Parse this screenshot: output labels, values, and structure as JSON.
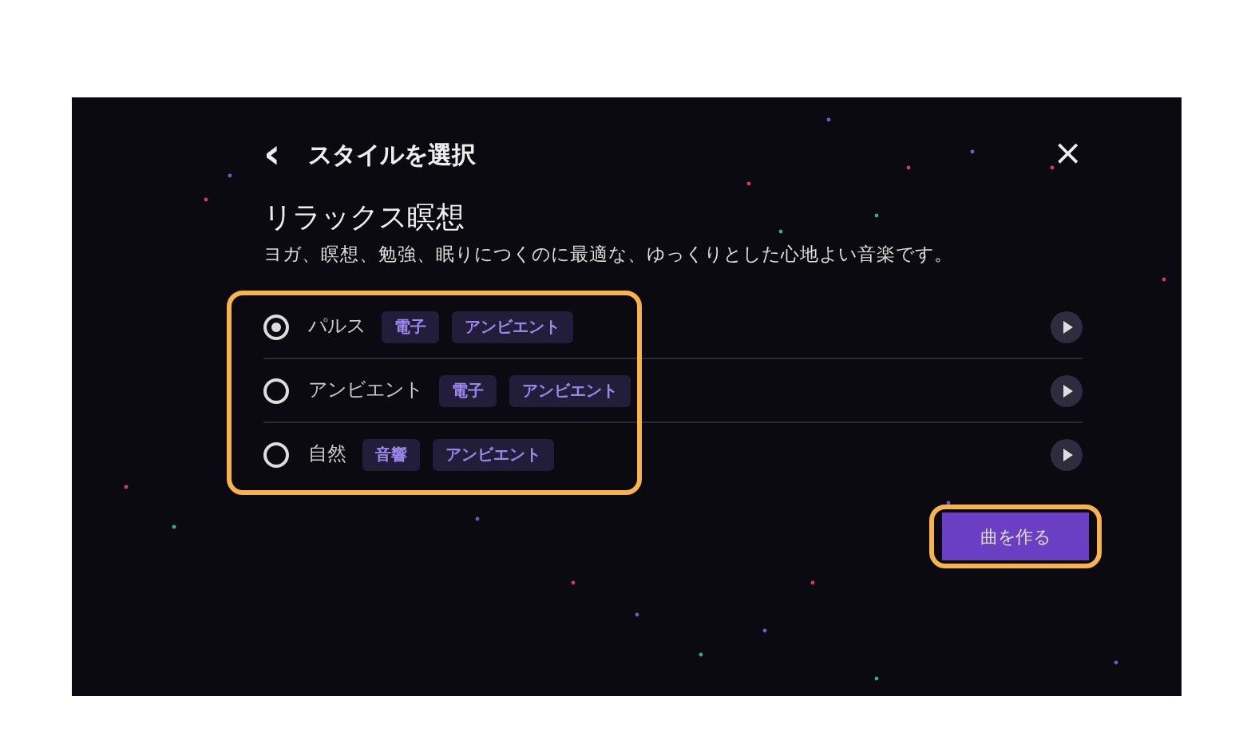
{
  "header": {
    "back": "‹",
    "title": "スタイルを選択",
    "close": "×"
  },
  "heading": "リラックス瞑想",
  "description": "ヨガ、瞑想、勉強、眠りにつくのに最適な、ゆっくりとした心地よい音楽です。",
  "styles": [
    {
      "name": "パルス",
      "selected": true,
      "tags": [
        "電子",
        "アンビエント"
      ]
    },
    {
      "name": "アンビエント",
      "selected": false,
      "tags": [
        "電子",
        "アンビエント"
      ]
    },
    {
      "name": "自然",
      "selected": false,
      "tags": [
        "音響",
        "アンビエント"
      ]
    }
  ],
  "create_button": "曲を作る"
}
